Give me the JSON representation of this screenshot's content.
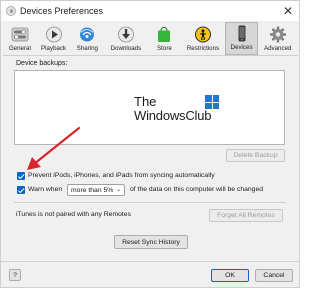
{
  "window": {
    "title": "Devices Preferences",
    "close": "✕"
  },
  "toolbar": {
    "items": [
      {
        "label": "General",
        "icon": "toggle-switch-icon"
      },
      {
        "label": "Playback",
        "icon": "play-icon"
      },
      {
        "label": "Sharing",
        "icon": "sharing-icon"
      },
      {
        "label": "Downloads",
        "icon": "downloads-icon"
      },
      {
        "label": "Store",
        "icon": "store-bag-icon"
      },
      {
        "label": "Restrictions",
        "icon": "restrictions-icon"
      },
      {
        "label": "Devices",
        "icon": "phone-icon",
        "selected": true
      },
      {
        "label": "Advanced",
        "icon": "gear-icon"
      }
    ]
  },
  "backups": {
    "label": "Device backups:",
    "logo_line1": "The",
    "logo_line2": "WindowsClub",
    "delete_button": "Delete Backup"
  },
  "options": {
    "prevent_sync": "Prevent iPods, iPhones, and iPads from syncing automatically",
    "warn_prefix": "Warn when",
    "warn_select": "more than 5%",
    "warn_suffix": "of the data on this computer will be changed"
  },
  "remotes": {
    "status": "iTunes is not paired with any Remotes",
    "forget_button": "Forget All Remotes"
  },
  "reset_button": "Reset Sync History",
  "footer": {
    "help": "?",
    "ok": "OK",
    "cancel": "Cancel"
  },
  "colors": {
    "accent": "#0a64c9",
    "arrow": "#d9272e",
    "logo_blue": "#1f77d0"
  }
}
